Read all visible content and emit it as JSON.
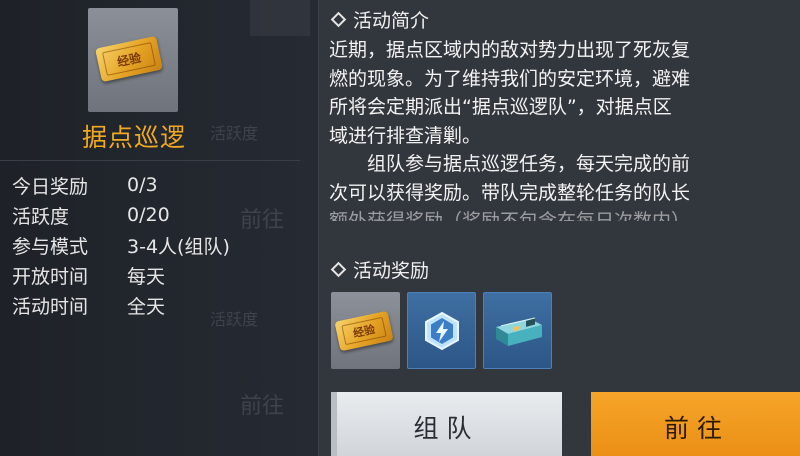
{
  "event": {
    "title": "据点巡逻",
    "icon_text": "经验"
  },
  "info": [
    {
      "key": "今日奖励",
      "value": "0/3"
    },
    {
      "key": "活跃度",
      "value": "0/20"
    },
    {
      "key": "参与模式",
      "value": "3-4人(组队)"
    },
    {
      "key": "开放时间",
      "value": "每天"
    },
    {
      "key": "活动时间",
      "value": "全天"
    }
  ],
  "intro": {
    "heading": "活动简介",
    "lines": [
      "近期，据点区域内的敌对势力出现了死灰复",
      "燃的现象。为了维持我们的安定环境，避难",
      "所将会定期派出“据点巡逻队”，对据点区",
      "域进行排查清剿。",
      "　　组队参与据点巡逻任务，每天完成的前",
      "次可以获得奖励。带队完成整轮任务的队长",
      "额外获得奖励（奖励不包含在每日次数内）"
    ]
  },
  "rewards": {
    "heading": "活动奖励",
    "items": [
      {
        "icon": "exp-ticket-icon",
        "label": "经验"
      },
      {
        "icon": "energy-hexagon-icon"
      },
      {
        "icon": "supply-chest-icon"
      }
    ]
  },
  "buttons": {
    "team": "组队",
    "go": "前往"
  },
  "ghost": {
    "go1": "前往",
    "go2": "前往",
    "activity1": "活跃度",
    "activity2": "活跃度"
  }
}
